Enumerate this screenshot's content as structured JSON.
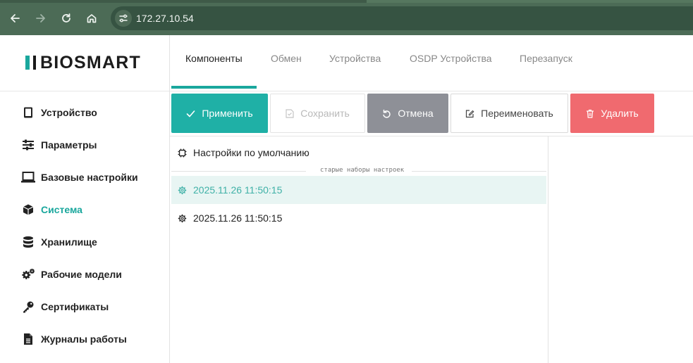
{
  "browser": {
    "url": "172.27.10.54",
    "icons": [
      "back-arrow-icon",
      "forward-arrow-icon",
      "reload-icon",
      "home-icon",
      "site-info-icon"
    ]
  },
  "app": {
    "logo_text": "BIOSMART"
  },
  "sidebar": {
    "items": [
      {
        "label": "Устройство",
        "icon": "tablet-icon"
      },
      {
        "label": "Параметры",
        "icon": "sliders-icon"
      },
      {
        "label": "Базовые настройки",
        "icon": "laptop-icon"
      },
      {
        "label": "Система",
        "icon": "cube-icon",
        "active": true
      },
      {
        "label": "Хранилище",
        "icon": "database-icon"
      },
      {
        "label": "Рабочие модели",
        "icon": "gears-icon"
      },
      {
        "label": "Сертификаты",
        "icon": "key-icon"
      },
      {
        "label": "Журналы работы",
        "icon": "file-icon"
      }
    ]
  },
  "tabs": [
    {
      "label": "Компоненты",
      "active": true
    },
    {
      "label": "Обмен"
    },
    {
      "label": "Устройства"
    },
    {
      "label": "OSDP Устройства"
    },
    {
      "label": "Перезапуск"
    }
  ],
  "toolbar": {
    "apply_label": "Применить",
    "save_label": "Сохранить",
    "cancel_label": "Отмена",
    "rename_label": "Переименовать",
    "delete_label": "Удалить"
  },
  "presets": {
    "default_label": "Настройки по умолчанию",
    "old_sets_label": "старые наборы настроек",
    "items": [
      {
        "label": "2025.11.26 11:50:15",
        "selected": true
      },
      {
        "label": "2025.11.26 11:50:15",
        "selected": false
      }
    ]
  },
  "colors": {
    "accent": "#1fb0a6",
    "cancel": "#8e9097",
    "delete": "#f06a6f",
    "browser_bar": "#4c6b56",
    "selected_row": "#e8f5f3"
  }
}
